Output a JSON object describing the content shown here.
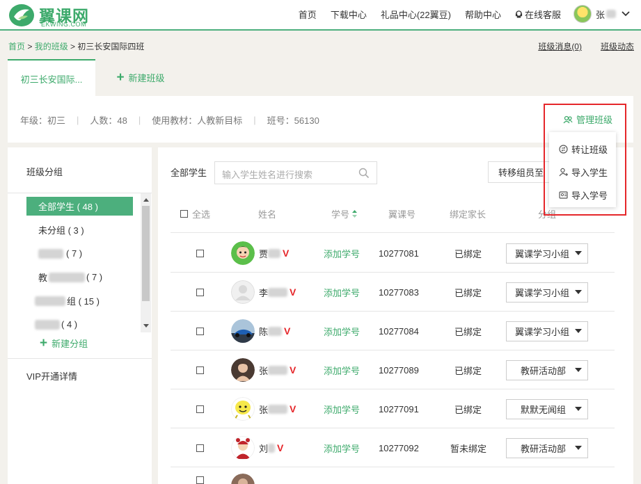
{
  "header": {
    "logo_cn": "翼课网",
    "logo_en": "EKWING.COM",
    "nav": [
      "首页",
      "下载中心",
      "礼品中心(22翼豆)",
      "帮助中心"
    ],
    "service": "在线客服",
    "user_name": "张"
  },
  "breadcrumb": {
    "home": "首页",
    "sep1": " > ",
    "my_class": "我的班级",
    "sep2": " > ",
    "current": "初三长安国际四班"
  },
  "top_links": {
    "messages": "班级消息(0)",
    "dynamics": "班级动态"
  },
  "tabs": {
    "active": "初三长安国际...",
    "new_class": "新建班级"
  },
  "class_info": {
    "grade": "年级：初三",
    "count": "人数：48",
    "textbook": "使用教材：人教新目标",
    "class_no": "班号：56130"
  },
  "manage": {
    "label": "管理班级",
    "menu": [
      "转让班级",
      "导入学生",
      "导入学号"
    ]
  },
  "sidebar": {
    "title": "班级分组",
    "groups": [
      {
        "label": "全部学生 ( 48 )"
      },
      {
        "label": "未分组 ( 3 )"
      },
      {
        "label": "( 7 )"
      },
      {
        "label": "教",
        "suffix": "( 7 )"
      },
      {
        "label": "组 ( 15 )"
      },
      {
        "label": "( 4 )"
      }
    ],
    "new_group": "新建分组",
    "vip": "VIP开通详情"
  },
  "main": {
    "filter_label": "全部学生",
    "search_placeholder": "输入学生姓名进行搜索",
    "move_button": "转移组员至",
    "columns": {
      "select_all": "全选",
      "name": "姓名",
      "student_no": "学号",
      "ekwing_no": "翼课号",
      "parent": "绑定家长",
      "group": "分组"
    },
    "rows": [
      {
        "name": "贾",
        "vip": "V",
        "add_id": "添加学号",
        "ekwing_no": "10277081",
        "parent": "已绑定",
        "group": "翼课学习小组",
        "avatar": "green-cartoon"
      },
      {
        "name": "李",
        "vip": "V",
        "add_id": "添加学号",
        "ekwing_no": "10277083",
        "parent": "已绑定",
        "group": "翼课学习小组",
        "avatar": "default"
      },
      {
        "name": "陈",
        "vip": "V",
        "add_id": "添加学号",
        "ekwing_no": "10277084",
        "parent": "已绑定",
        "group": "翼课学习小组",
        "avatar": "car"
      },
      {
        "name": "张",
        "vip": "V",
        "add_id": "添加学号",
        "ekwing_no": "10277089",
        "parent": "已绑定",
        "group": "教研活动部",
        "avatar": "person"
      },
      {
        "name": "张",
        "vip": "V",
        "add_id": "添加学号",
        "ekwing_no": "10277091",
        "parent": "已绑定",
        "group": "默默无闻组",
        "avatar": "yellow-cartoon"
      },
      {
        "name": "刘",
        "vip": "V",
        "add_id": "添加学号",
        "ekwing_no": "10277092",
        "parent": "暂未绑定",
        "group": "教研活动部",
        "avatar": "red-girl"
      }
    ]
  }
}
